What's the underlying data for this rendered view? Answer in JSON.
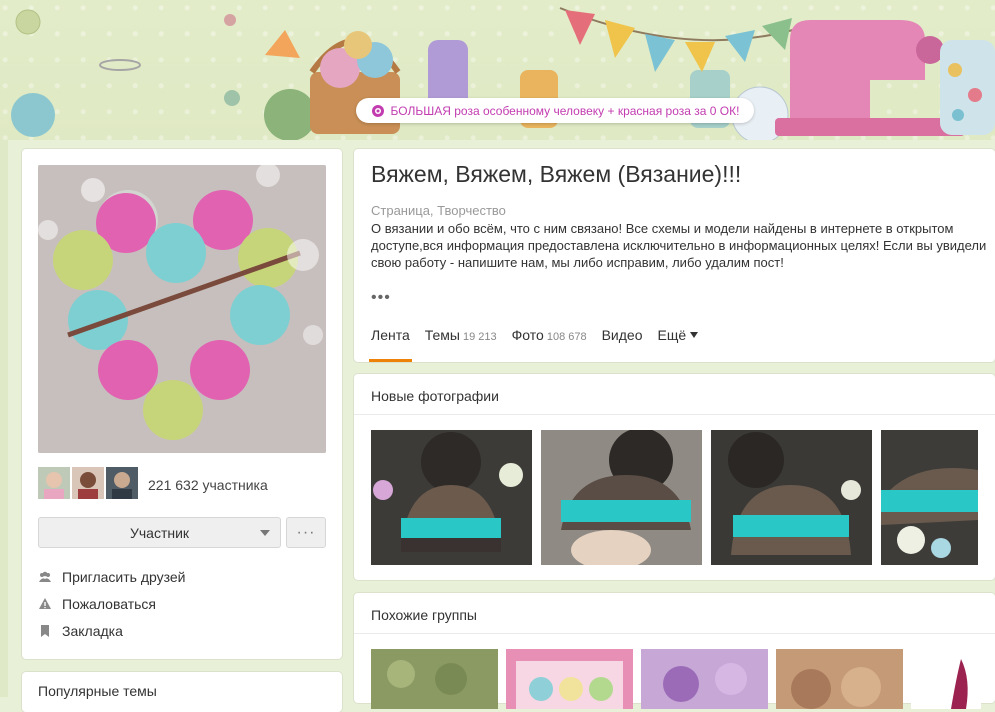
{
  "banner": {
    "promo_text": "БОЛЬШАЯ роза особенному человеку + красная роза за 0 ОК!"
  },
  "sidebar": {
    "members_count": "221 632 участника",
    "join_button": "Участник",
    "more_button": "···",
    "actions": [
      {
        "label": "Пригласить друзей",
        "icon": "invite-friends-icon"
      },
      {
        "label": "Пожаловаться",
        "icon": "warning-icon"
      },
      {
        "label": "Закладка",
        "icon": "bookmark-icon"
      }
    ],
    "popular_title": "Популярные темы"
  },
  "group": {
    "title": "Вяжем, Вяжем, Вяжем (Вязание)!!!",
    "category": "Страница, Творчество",
    "description": "О вязании и обо всём, что с ним связано! Все схемы и модели найдены в интернете в открытом доступе,вся информация предоставлена исключительно в информационных целях! Если вы увидели свою работу - напишите нам, мы либо исправим, либо удалим пост!",
    "ellipsis": "•••"
  },
  "tabs": [
    {
      "label": "Лента",
      "count": ""
    },
    {
      "label": "Темы",
      "count": "19 213"
    },
    {
      "label": "Фото",
      "count": "108 678"
    },
    {
      "label": "Видео",
      "count": ""
    },
    {
      "label": "Ещё",
      "count": ""
    }
  ],
  "photos": {
    "title": "Новые фотографии"
  },
  "similar": {
    "title": "Похожие группы"
  },
  "colors": {
    "accent": "#ee8208",
    "promo": "#c23cb0"
  }
}
